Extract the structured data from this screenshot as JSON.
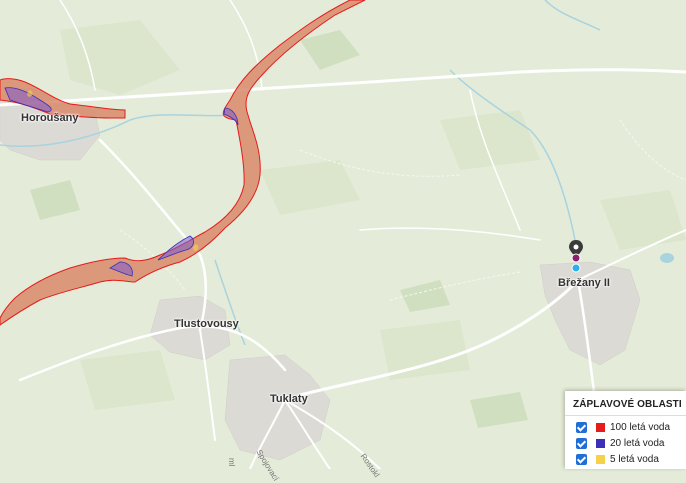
{
  "places": {
    "horousany": "Horoušany",
    "tlustovousy": "Tlustovousy",
    "tuklaty": "Tuklaty",
    "brezany": "Břežany II"
  },
  "streets": {
    "spojovaci": "Spojovací",
    "rostoklatska": "Rostokl",
    "partial": "ml"
  },
  "legend": {
    "title": "ZÁPLAVOVÉ OBLASTI",
    "items": [
      {
        "label": "100 letá voda",
        "color": "#e51c1c",
        "checked": true
      },
      {
        "label": "20 letá voda",
        "color": "#3c2fb8",
        "checked": true
      },
      {
        "label": "5 letá voda",
        "color": "#f5d24a",
        "checked": true
      }
    ]
  },
  "colors": {
    "land": "#e4ecd9",
    "flood_fill": "#d98a6a",
    "river": "#a9d3de"
  }
}
